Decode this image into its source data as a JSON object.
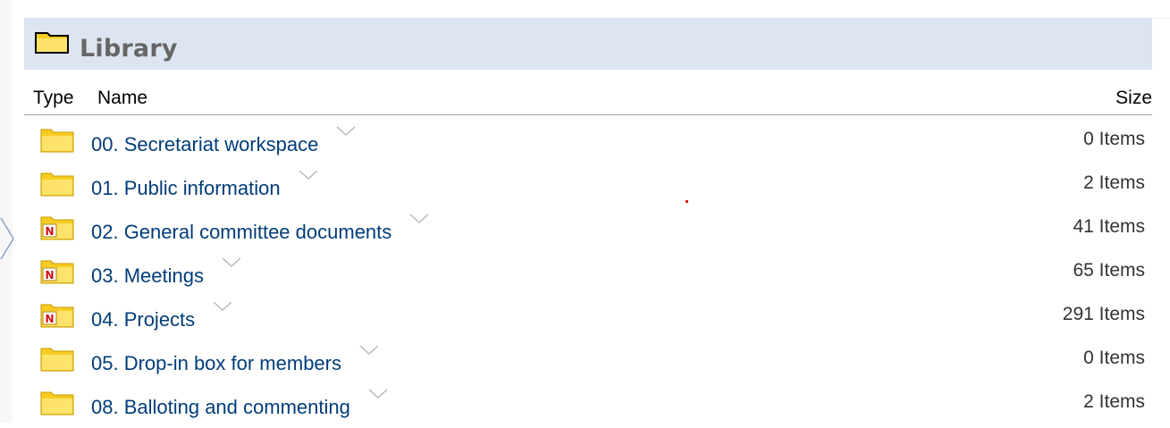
{
  "library": {
    "title": "Library",
    "columns": {
      "type": "Type",
      "name": "Name",
      "size": "Size"
    },
    "items": [
      {
        "name": "00. Secretariat workspace",
        "size": "0 Items",
        "icon": "folder-icon"
      },
      {
        "name": "01. Public information",
        "size": "2 Items",
        "icon": "folder-icon"
      },
      {
        "name": "02. General committee documents",
        "size": "41 Items",
        "icon": "new-folder-icon"
      },
      {
        "name": "03. Meetings",
        "size": "65 Items",
        "icon": "new-folder-icon"
      },
      {
        "name": "04. Projects",
        "size": "291 Items",
        "icon": "new-folder-icon"
      },
      {
        "name": "05. Drop-in box for members",
        "size": "0 Items",
        "icon": "folder-icon"
      },
      {
        "name": "08. Balloting and commenting",
        "size": "2 Items",
        "icon": "folder-icon"
      }
    ],
    "new_badge": "N"
  },
  "colors": {
    "header_bg": "#dde5f2",
    "link": "#003d7a",
    "folder_yellow": "#f6cc22",
    "badge_red": "#d01010"
  }
}
